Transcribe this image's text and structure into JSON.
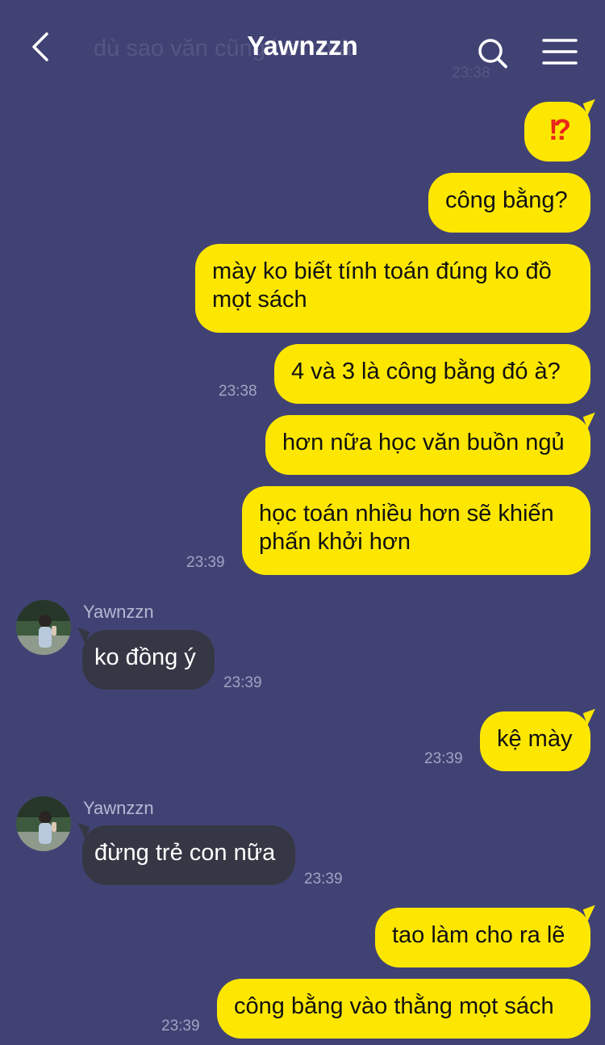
{
  "header": {
    "title": "Yawnzzn",
    "ghost_message": "dù sao văn cũng hơn mà",
    "ghost_time": "23:38",
    "back_icon": "chevron-left-icon",
    "search_icon": "search-icon",
    "menu_icon": "hamburger-menu-icon"
  },
  "colors": {
    "background": "#414274",
    "outgoing_bubble": "#fde701",
    "incoming_bubble": "#363744",
    "timestamp": "#a2a3c2"
  },
  "messages": [
    {
      "dir": "out",
      "text": "⁉️",
      "time": ""
    },
    {
      "dir": "out",
      "text": "công bằng?",
      "time": ""
    },
    {
      "dir": "out",
      "text": "mày ko biết tính toán đúng ko đồ mọt sách",
      "time": ""
    },
    {
      "dir": "out",
      "text": "4 và 3 là công bằng đó à?",
      "time": "23:38"
    },
    {
      "dir": "out",
      "text": "hơn nữa học văn buồn ngủ",
      "time": ""
    },
    {
      "dir": "out",
      "text": "học toán nhiều hơn sẽ khiến phấn khởi hơn",
      "time": "23:39"
    },
    {
      "dir": "in",
      "sender": "Yawnzzn",
      "text": "ko đồng ý",
      "time": "23:39"
    },
    {
      "dir": "out",
      "text": "kệ mày",
      "time": "23:39"
    },
    {
      "dir": "in",
      "sender": "Yawnzzn",
      "text": "đừng trẻ con nữa",
      "time": "23:39"
    },
    {
      "dir": "out",
      "text": "tao làm cho ra lẽ",
      "time": ""
    },
    {
      "dir": "out",
      "text": "công bằng vào thằng mọt sách",
      "time": "23:39"
    }
  ]
}
